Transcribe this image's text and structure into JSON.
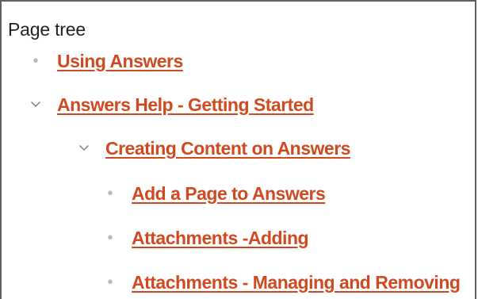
{
  "page_tree": {
    "title": "Page tree",
    "items": [
      {
        "label": "Using Answers",
        "icon": "bullet-icon"
      },
      {
        "label": "Answers Help - Getting Started",
        "icon": "chevron-down-icon"
      },
      {
        "label": "Creating Content on Answers",
        "icon": "chevron-down-icon"
      },
      {
        "label": "Add a Page to Answers",
        "icon": "bullet-icon"
      },
      {
        "label": "Attachments -Adding",
        "icon": "bullet-icon"
      },
      {
        "label": "Attachments - Managing and Removing",
        "icon": "bullet-icon"
      }
    ]
  },
  "colors": {
    "link": "#d04a21",
    "title": "#222222",
    "bullet": "#b8b8b8",
    "border": "#5f5f5f"
  }
}
